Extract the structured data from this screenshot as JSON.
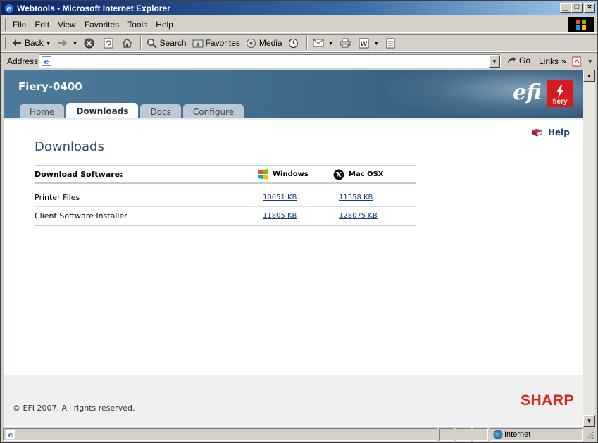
{
  "window": {
    "title": "Webtools - Microsoft Internet Explorer"
  },
  "menubar": {
    "items": [
      "File",
      "Edit",
      "View",
      "Favorites",
      "Tools",
      "Help"
    ]
  },
  "toolbar": {
    "back": "Back",
    "search": "Search",
    "favorites": "Favorites",
    "media": "Media"
  },
  "addressbar": {
    "label": "Address",
    "url": "",
    "go": "Go",
    "links": "Links"
  },
  "header": {
    "device_name": "Fiery-0400",
    "efi_logo": "efi",
    "fiery_logo": "fiery",
    "tabs": [
      "Home",
      "Downloads",
      "Docs",
      "Configure"
    ],
    "active_tab": "Downloads"
  },
  "help": {
    "label": "Help"
  },
  "page": {
    "title": "Downloads",
    "table": {
      "header_label": "Download Software:",
      "col_windows": "Windows",
      "col_mac": "Mac OSX",
      "rows": [
        {
          "name": "Printer Files",
          "windows": "10051 KB",
          "mac": "11558 KB"
        },
        {
          "name": "Client Software Installer",
          "windows": "11805 KB",
          "mac": "128075 KB"
        }
      ]
    }
  },
  "footer": {
    "copyright": "© EFI 2007, All rights reserved.",
    "brand": "SHARP"
  },
  "statusbar": {
    "zone": "Internet"
  }
}
